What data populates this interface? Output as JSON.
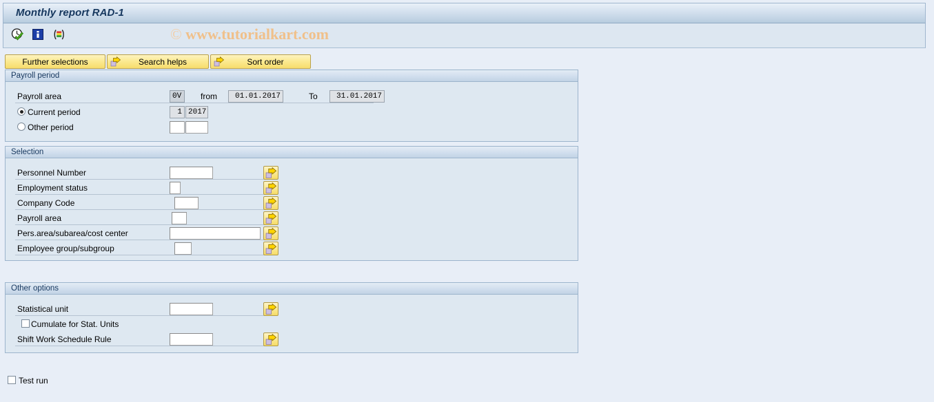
{
  "window": {
    "title": "Monthly report RAD-1"
  },
  "watermark": {
    "symbol": "©",
    "text": "www.tutorialkart.com"
  },
  "toolbar": {
    "icons": [
      {
        "name": "execute-clock-check-icon",
        "title": "Execute"
      },
      {
        "name": "info-icon",
        "title": "Information"
      },
      {
        "name": "variants-icon",
        "title": "Get Variant"
      }
    ]
  },
  "buttons": [
    {
      "label": "Further selections",
      "icon": null
    },
    {
      "label": "Search helps",
      "icon": "arrow-right-icon"
    },
    {
      "label": "Sort order",
      "icon": "arrow-right-icon"
    }
  ],
  "panels": {
    "payroll_period": {
      "header": "Payroll period",
      "payroll_area_label": "Payroll area",
      "payroll_area_value": "0V",
      "from_label": "from",
      "from_value": "01.01.2017",
      "to_label": "To",
      "to_value": "31.01.2017",
      "current_period_label": "Current period",
      "current_period_selected": true,
      "current_period_value": "1",
      "current_year_value": "2017",
      "other_period_label": "Other period",
      "other_period_selected": false,
      "other_period_value": "",
      "other_year_value": ""
    },
    "selection": {
      "header": "Selection",
      "rows": [
        {
          "label": "Personnel Number",
          "value": "",
          "button": "multiple-selection-icon"
        },
        {
          "label": "Employment status",
          "value": "",
          "button": "multiple-selection-icon"
        },
        {
          "label": "Company Code",
          "value": "",
          "button": "multiple-selection-icon"
        },
        {
          "label": "Payroll area",
          "value": "",
          "button": "multiple-selection-icon"
        },
        {
          "label": "Pers.area/subarea/cost center",
          "value": "",
          "button": "multiple-selection-icon"
        },
        {
          "label": "Employee group/subgroup",
          "value": "",
          "button": "multiple-selection-icon"
        }
      ]
    },
    "other_options": {
      "header": "Other options",
      "statistical_unit_label": "Statistical unit",
      "statistical_unit_value": "",
      "cumulate_label": "Cumulate for Stat. Units",
      "cumulate_checked": false,
      "shift_rule_label": "Shift Work Schedule Rule",
      "shift_rule_value": ""
    }
  },
  "footer": {
    "test_run_label": "Test run",
    "test_run_checked": false
  },
  "colors": {
    "page_background": "#e8eef7",
    "panel_background": "#dee8f1",
    "panel_border": "#9cb4cc",
    "title_text": "#16375e",
    "button_yellow": "#fbe98f",
    "watermark": "#f0c08a"
  }
}
